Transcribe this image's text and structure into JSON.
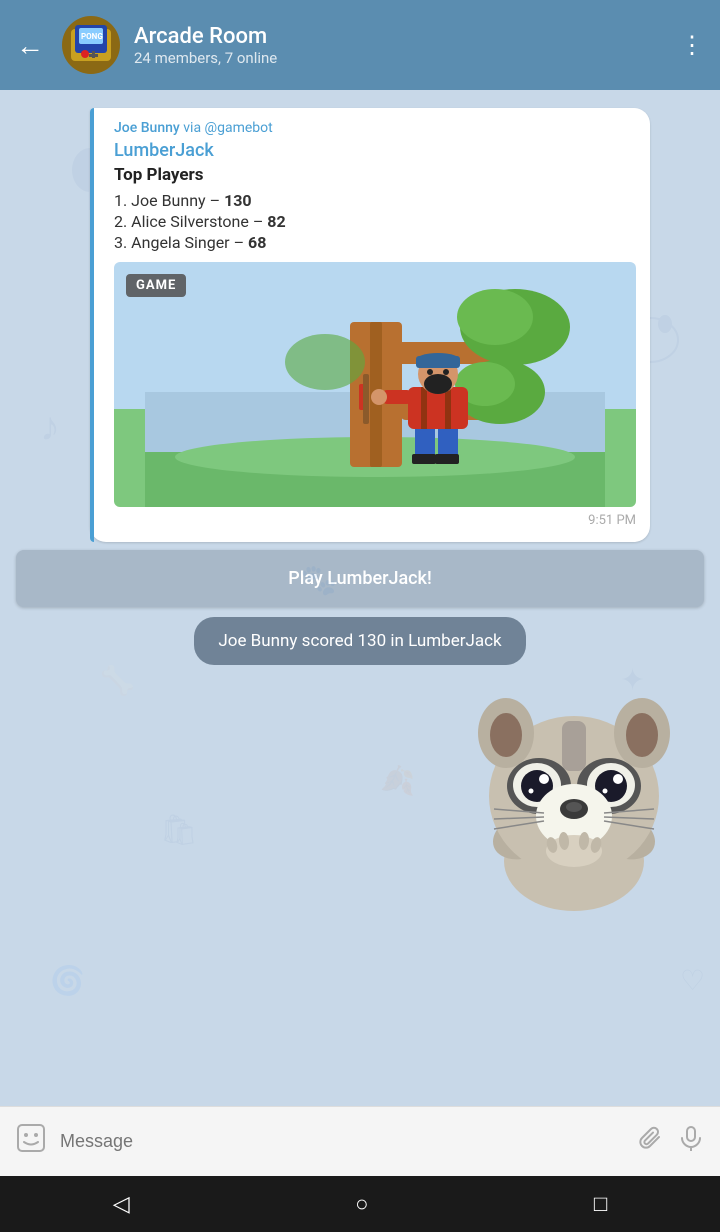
{
  "header": {
    "title": "Arcade Room",
    "subtitle": "24 members, 7 online",
    "back_label": "←",
    "menu_label": "⋮"
  },
  "message": {
    "sender": "Joe Bunny",
    "via": "via @gamebot",
    "game_name": "LumberJack",
    "top_players_title": "Top Players",
    "players": [
      {
        "rank": "1.",
        "name": "Joe Bunny",
        "dash": "–",
        "score": "130"
      },
      {
        "rank": "2.",
        "name": "Alice Silverstone",
        "dash": "–",
        "score": "82"
      },
      {
        "rank": "3.",
        "name": "Angela Singer",
        "dash": "–",
        "score": "68"
      }
    ],
    "game_label": "GAME",
    "time": "9:51 PM"
  },
  "play_button": {
    "label": "Play LumberJack!"
  },
  "score_notification": {
    "text": "Joe Bunny scored 130 in LumberJack"
  },
  "input": {
    "placeholder": "Message"
  },
  "nav": {
    "back": "◁",
    "home": "○",
    "recent": "□"
  }
}
